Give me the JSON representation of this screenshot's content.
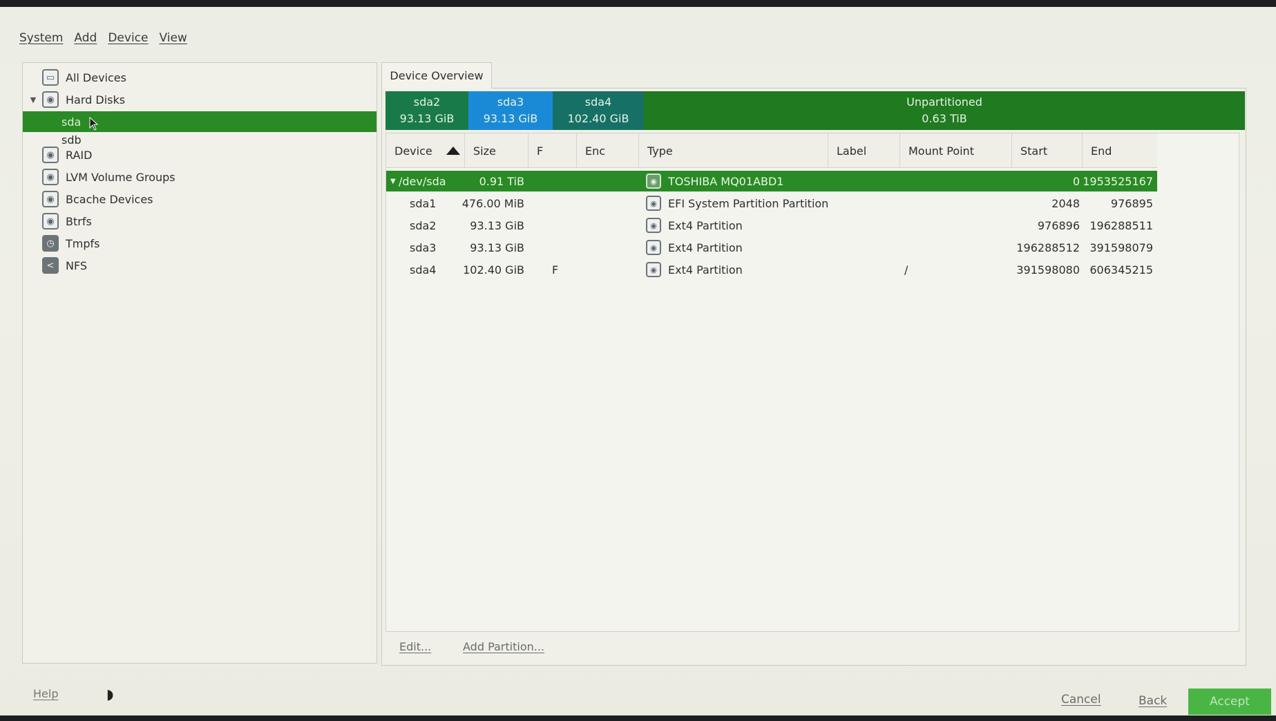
{
  "menubar": {
    "items": [
      "System",
      "Add",
      "Device",
      "View"
    ]
  },
  "sidebar": {
    "items": [
      {
        "label": "All Devices",
        "icon": "monitor-icon"
      },
      {
        "label": "Hard Disks",
        "icon": "hard-disk-icon",
        "expanded": true
      },
      {
        "label": "sda",
        "child": true,
        "selected": true
      },
      {
        "label": "sdb",
        "child": true
      },
      {
        "label": "RAID",
        "icon": "raid-icon"
      },
      {
        "label": "LVM Volume Groups",
        "icon": "lvm-icon"
      },
      {
        "label": "Bcache Devices",
        "icon": "bcache-icon"
      },
      {
        "label": "Btrfs",
        "icon": "btrfs-icon"
      },
      {
        "label": "Tmpfs",
        "icon": "tmpfs-icon"
      },
      {
        "label": "NFS",
        "icon": "nfs-icon"
      }
    ]
  },
  "tab": {
    "label": "Device Overview"
  },
  "partition_bar": {
    "segments": [
      {
        "name": "sda2",
        "size": "93.13 GiB",
        "color": "#197a49"
      },
      {
        "name": "sda3",
        "size": "93.13 GiB",
        "color": "#1b8ad6"
      },
      {
        "name": "sda4",
        "size": "102.40 GiB",
        "color": "#167066"
      },
      {
        "name": "Unpartitioned",
        "size": "0.63 TiB",
        "color": "#207a1f"
      }
    ]
  },
  "table": {
    "columns": [
      "Device",
      "Size",
      "F",
      "Enc",
      "Type",
      "Label",
      "Mount Point",
      "Start",
      "End"
    ],
    "rows": [
      {
        "device": "/dev/sda",
        "size": "0.91 TiB",
        "f": "",
        "enc": "",
        "type": "TOSHIBA MQ01ABD1",
        "label": "",
        "mount": "",
        "start": "0",
        "end": "1953525167",
        "selected": true
      },
      {
        "device": "sda1",
        "size": "476.00 MiB",
        "f": "",
        "enc": "",
        "type": "EFI System Partition Partition",
        "label": "",
        "mount": "",
        "start": "2048",
        "end": "976895"
      },
      {
        "device": "sda2",
        "size": "93.13 GiB",
        "f": "",
        "enc": "",
        "type": "Ext4 Partition",
        "label": "",
        "mount": "",
        "start": "976896",
        "end": "196288511"
      },
      {
        "device": "sda3",
        "size": "93.13 GiB",
        "f": "",
        "enc": "",
        "type": "Ext4 Partition",
        "label": "",
        "mount": "",
        "start": "196288512",
        "end": "391598079"
      },
      {
        "device": "sda4",
        "size": "102.40 GiB",
        "f": "F",
        "enc": "",
        "type": "Ext4 Partition",
        "label": "",
        "mount": "/",
        "start": "391598080",
        "end": "606345215"
      }
    ]
  },
  "actions": {
    "edit": "Edit...",
    "add_partition": "Add Partition..."
  },
  "footer": {
    "help": "Help",
    "cancel": "Cancel",
    "back": "Back",
    "accept": "Accept"
  }
}
